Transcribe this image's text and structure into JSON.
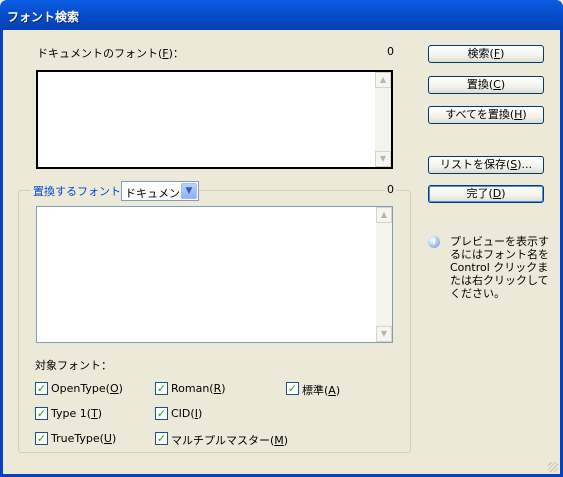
{
  "window": {
    "title": "フォント検索"
  },
  "document_fonts": {
    "label": "ドキュメントのフォント(",
    "accel": "F",
    "suffix": ")：",
    "count": "0"
  },
  "replace_fonts": {
    "label": "置換するフォント：",
    "count": "0",
    "source_select": "ドキュメント"
  },
  "buttons": {
    "find": {
      "label": "検索(",
      "accel": "F",
      "suffix": ")"
    },
    "replace": {
      "label": "置換(",
      "accel": "C",
      "suffix": ")"
    },
    "replace_all": {
      "label": "すべてを置換(",
      "accel": "H",
      "suffix": ")"
    },
    "save_list": {
      "label": "リストを保存(",
      "accel": "S",
      "suffix": ")..."
    },
    "done": {
      "label": "完了(",
      "accel": "D",
      "suffix": ")"
    }
  },
  "target_fonts": {
    "label": "対象フォント：",
    "checkboxes": [
      {
        "label": "OpenType(",
        "accel": "O",
        "suffix": ")",
        "checked": true
      },
      {
        "label": "Roman(",
        "accel": "R",
        "suffix": ")",
        "checked": true
      },
      {
        "label": "標準(",
        "accel": "A",
        "suffix": ")",
        "checked": true
      },
      {
        "label": "Type 1(",
        "accel": "T",
        "suffix": ")",
        "checked": true
      },
      {
        "label": "CID(",
        "accel": "I",
        "suffix": ")",
        "checked": true
      },
      {
        "label": "TrueType(",
        "accel": "U",
        "suffix": ")",
        "checked": true
      },
      {
        "label": "マルチプルマスター(",
        "accel": "M",
        "suffix": ")",
        "checked": true
      }
    ]
  },
  "hint": {
    "icon": "info-icon",
    "text": "プレビューを表示するにはフォント名をControl クリックまたは右クリックしてください。"
  }
}
